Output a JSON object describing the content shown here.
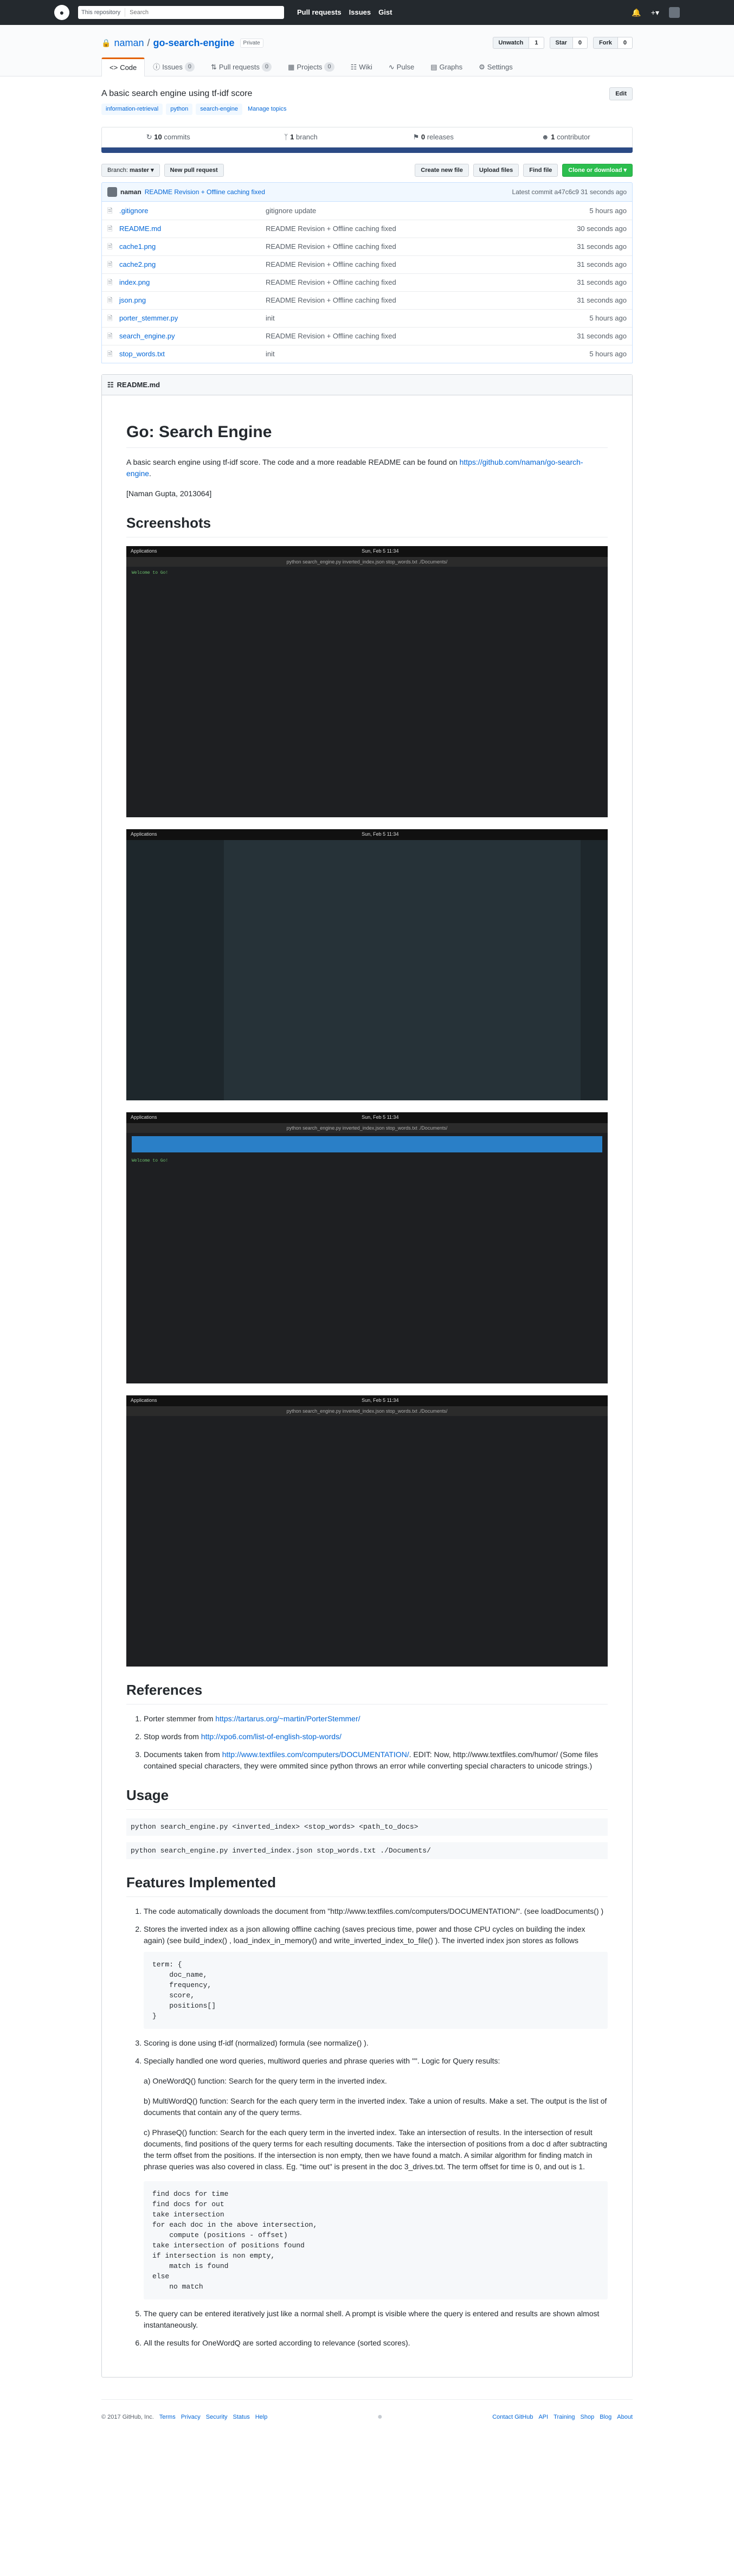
{
  "header": {
    "scope": "This repository",
    "search_placeholder": "Search",
    "nav": [
      "Pull requests",
      "Issues",
      "Gist"
    ]
  },
  "repo": {
    "owner": "naman",
    "name": "go-search-engine",
    "badge": "Private",
    "watch": "Unwatch",
    "watch_count": "1",
    "star": "Star",
    "star_count": "0",
    "fork": "Fork",
    "fork_count": "0",
    "tabs": [
      {
        "label": "Code",
        "count": ""
      },
      {
        "label": "Issues",
        "count": "0"
      },
      {
        "label": "Pull requests",
        "count": "0"
      },
      {
        "label": "Projects",
        "count": "0"
      },
      {
        "label": "Wiki",
        "count": ""
      },
      {
        "label": "Pulse",
        "count": ""
      },
      {
        "label": "Graphs",
        "count": ""
      },
      {
        "label": "Settings",
        "count": ""
      }
    ],
    "description": "A basic search engine using tf-idf score",
    "edit": "Edit",
    "topics": [
      "information-retrieval",
      "python",
      "search-engine",
      "Manage topics"
    ]
  },
  "summary": {
    "commits": "10",
    "commits_label": "commits",
    "branches": "1",
    "branches_label": "branch",
    "releases": "0",
    "releases_label": "releases",
    "contributors": "1",
    "contributors_label": "contributor"
  },
  "filenav": {
    "branch_label": "Branch:",
    "branch": "master",
    "new_pr": "New pull request",
    "create": "Create new file",
    "upload": "Upload files",
    "find": "Find file",
    "clone": "Clone or download"
  },
  "commit": {
    "author": "naman",
    "message": "README Revision + Offline caching fixed",
    "latest": "Latest commit a47c6c9 31 seconds ago"
  },
  "files": [
    {
      "name": ".gitignore",
      "msg": "gitignore update",
      "age": "5 hours ago"
    },
    {
      "name": "README.md",
      "msg": "README Revision + Offline caching fixed",
      "age": "30 seconds ago"
    },
    {
      "name": "cache1.png",
      "msg": "README Revision + Offline caching fixed",
      "age": "31 seconds ago"
    },
    {
      "name": "cache2.png",
      "msg": "README Revision + Offline caching fixed",
      "age": "31 seconds ago"
    },
    {
      "name": "index.png",
      "msg": "README Revision + Offline caching fixed",
      "age": "31 seconds ago"
    },
    {
      "name": "json.png",
      "msg": "README Revision + Offline caching fixed",
      "age": "31 seconds ago"
    },
    {
      "name": "porter_stemmer.py",
      "msg": "init",
      "age": "5 hours ago"
    },
    {
      "name": "search_engine.py",
      "msg": "README Revision + Offline caching fixed",
      "age": "31 seconds ago"
    },
    {
      "name": "stop_words.txt",
      "msg": "init",
      "age": "5 hours ago"
    }
  ],
  "readme": {
    "file": "README.md",
    "h1": "Go: Search Engine",
    "intro": "A basic search engine using tf-idf score. The code and a more readable README can be found on ",
    "intro_link": "https://github.com/naman/go-search-engine",
    "intro_end": ".",
    "author": "[Naman Gupta, 2013064]",
    "h_screens": "Screenshots",
    "h_refs": "References",
    "refs": [
      {
        "pre": "Porter stemmer from ",
        "link": "https://tartarus.org/~martin/PorterStemmer/",
        "post": ""
      },
      {
        "pre": "Stop words from ",
        "link": "http://xpo6.com/list-of-english-stop-words/",
        "post": ""
      },
      {
        "pre": "Documents taken from ",
        "link": "http://www.textfiles.com/computers/DOCUMENTATION/",
        "post": ". EDIT: Now, http://www.textfiles.com/humor/ (Some files contained special characters, they were ommited since python throws an error while converting special characters to unicode strings.)"
      }
    ],
    "h_usage": "Usage",
    "usage1": "python search_engine.py <inverted_index> <stop_words> <path_to_docs>",
    "usage2": "python search_engine.py inverted_index.json stop_words.txt ./Documents/",
    "h_features": "Features Implemented",
    "f1": "The code automatically downloads the document from \"http://www.textfiles.com/computers/DOCUMENTATION/\". (see loadDocuments() )",
    "f2": "Stores the inverted index as a json allowing offline caching (saves precious time, power and those CPU cycles on building the index again) (see build_index() , load_index_in_memory() and write_inverted_index_to_file() ). The inverted index json stores as follows",
    "f2_code": "term: {\n    doc_name,\n    frequency,\n    score,\n    positions[]\n}",
    "f3": "Scoring is done using tf-idf (normalized) formula (see normalize() ).",
    "f4": "Specially handled one word queries, multiword queries and phrase queries with \"\". Logic for Query results:",
    "f4a": "a) OneWordQ() function: Search for the query term in the inverted index.",
    "f4b": "b) MultiWordQ() function: Search for the each query term in the inverted index. Take a union of results. Make a set. The output is the list of documents that contain any of the query terms.",
    "f4c": "c) PhraseQ() function: Search for the each query term in the inverted index. Take an intersection of results. In the intersection of result documents, find positions of the query terms for each resulting documents. Take the intersection of positions from a doc d after subtracting the term offset from the positions. If the intersection is non empty, then we have found a match. A similar algorithm for finding match in phrase queries was also covered in class. Eg. \"time out\" is present in the doc 3_drives.txt. The term offset for time is 0, and out is 1.",
    "f4_code": "find docs for time\nfind docs for out\ntake intersection\nfor each doc in the above intersection,\n    compute (positions - offset)\ntake intersection of positions found\nif intersection is non empty,\n    match is found\nelse\n    no match",
    "f5": "The query can be entered iteratively just like a normal shell. A prompt is visible where the query is entered and results are shown almost instantaneously.",
    "f6": "All the results for OneWordQ are sorted according to relevance (sorted scores)."
  },
  "screens": {
    "bar_left": "Applications",
    "bar_center": "Sun, Feb 5  11:34",
    "term_title": "python search_engine.py inverted_index.json stop_words.txt ./Documents/",
    "welcome": "Welcome to Go!"
  },
  "footer": {
    "copy": "© 2017 GitHub, Inc.",
    "left": [
      "Terms",
      "Privacy",
      "Security",
      "Status",
      "Help"
    ],
    "right": [
      "Contact GitHub",
      "API",
      "Training",
      "Shop",
      "Blog",
      "About"
    ]
  }
}
